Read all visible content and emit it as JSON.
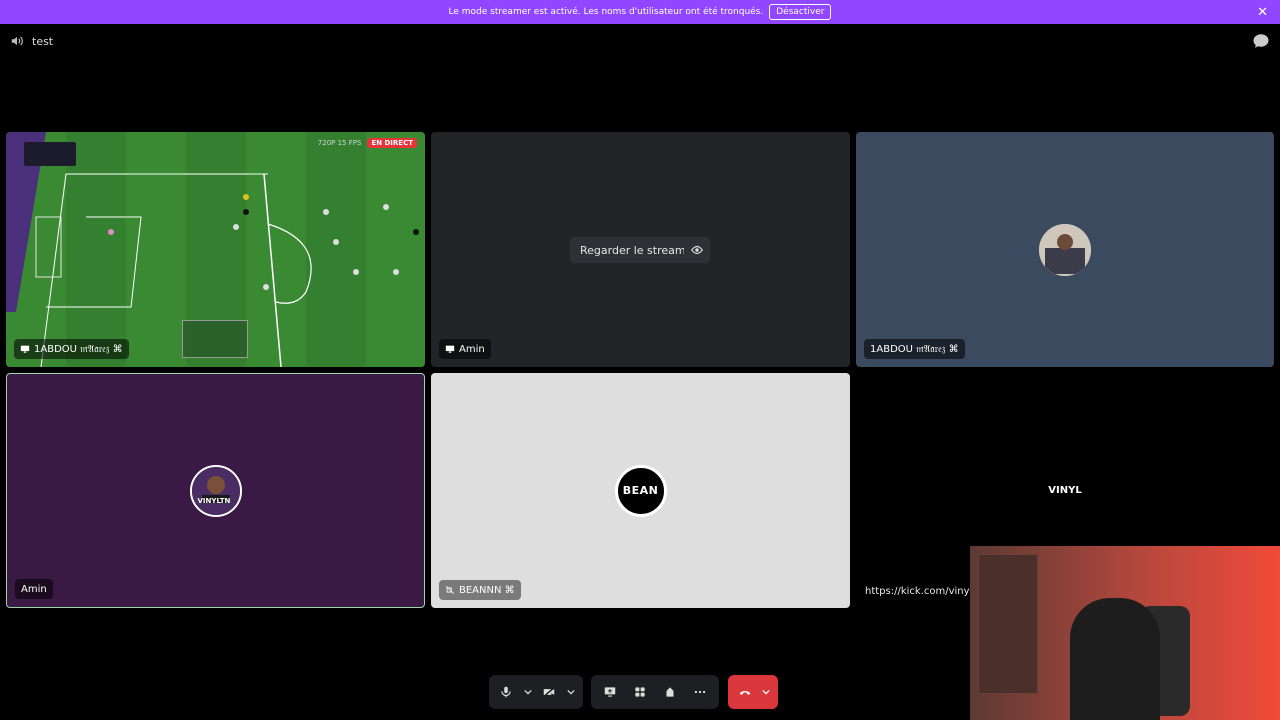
{
  "banner": {
    "message": "Le mode streamer est activé. Les noms d'utilisateur ont été tronqués.",
    "button_label": "Désactiver",
    "close_label": "✕",
    "color": "#9147ff"
  },
  "header": {
    "channel_title": "test",
    "speaker_icon": "speaker-icon",
    "chat_icon": "chat-bubble-icon"
  },
  "tiles": [
    {
      "name": "1ABDOU 𝔪𝔄𝔞𝔯𝔢𝔷 ⌘",
      "type": "stream",
      "quality": "720P 15 FPS",
      "live_badge": "EN DIRECT"
    },
    {
      "name": "Amin",
      "type": "stream-preview",
      "watch_label": "Regarder le stream"
    },
    {
      "name": "1ABDOU 𝔪𝔄𝔞𝔯𝔢𝔷 ⌘",
      "type": "avatar"
    },
    {
      "name": "Amin",
      "type": "avatar",
      "avatar_label": "VINYLTN"
    },
    {
      "name": "BEANNN ⌘",
      "type": "avatar",
      "avatar_label": "BEAN"
    },
    {
      "name": "",
      "type": "avatar",
      "avatar_label": "VINYL"
    }
  ],
  "overlay": {
    "kick_url": "https://kick.com/vinyl"
  },
  "controls": {
    "mic_icon": "microphone-icon",
    "camera_icon": "camera-off-icon",
    "share_icon": "screen-share-icon",
    "activities_icon": "activities-icon",
    "soundboard_icon": "soundboard-icon",
    "more_icon": "more-icon",
    "hangup_icon": "hang-up-icon",
    "hangup_color": "#da373c"
  }
}
